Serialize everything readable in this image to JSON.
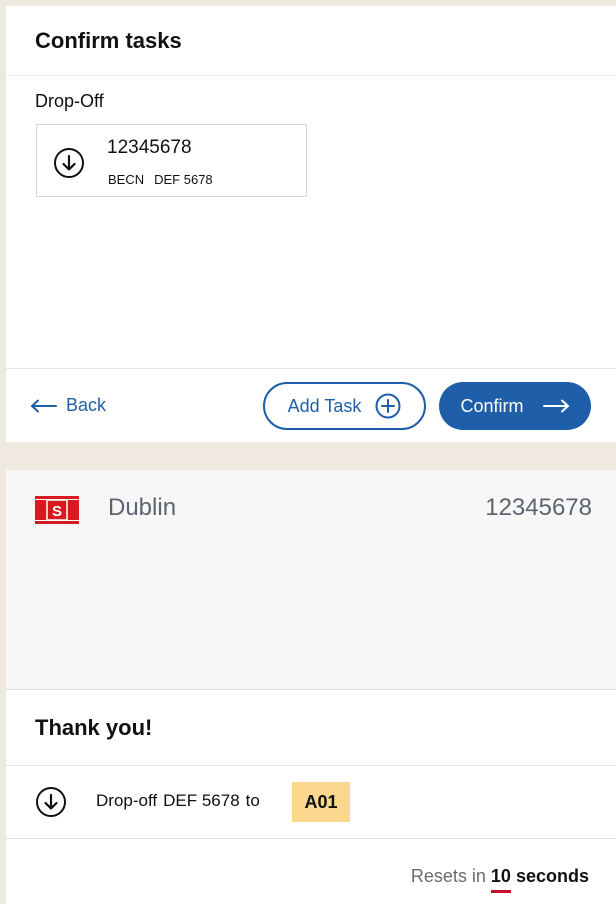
{
  "confirm": {
    "title": "Confirm tasks",
    "section_label": "Drop-Off",
    "task": {
      "id": "12345678",
      "terminal": "BECN",
      "plate": "DEF 5678"
    },
    "footer": {
      "back_label": "Back",
      "add_task_label": "Add Task",
      "confirm_label": "Confirm"
    }
  },
  "kiosk": {
    "brand_letter": "S",
    "location": "Dublin",
    "id": "12345678"
  },
  "thanks": {
    "title": "Thank you!",
    "result": {
      "action": "Drop-off",
      "plate": "DEF 5678",
      "connector": "to",
      "slot": "A01"
    },
    "reset_prefix": "Resets in",
    "reset_count": "10",
    "reset_unit": "seconds"
  },
  "colors": {
    "accent": "#1f5ea8",
    "slot_highlight": "#fcd88e",
    "brand_red": "#d71920",
    "countdown_underline": "#c8102e"
  }
}
